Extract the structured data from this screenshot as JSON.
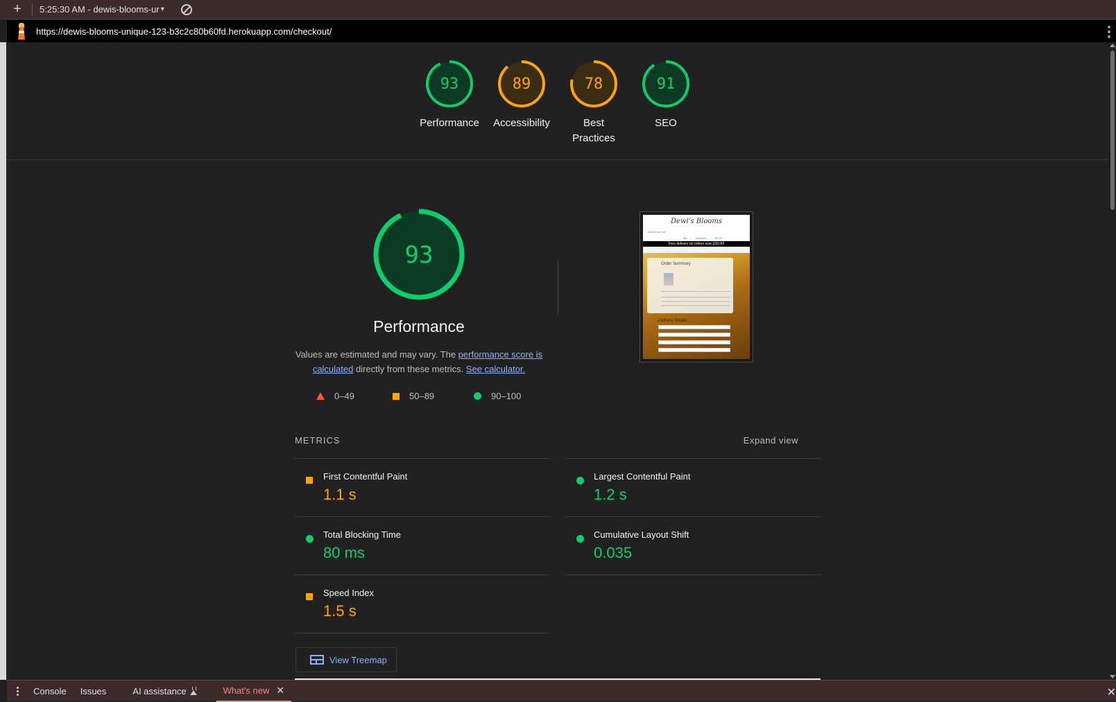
{
  "toolbar": {
    "plus": "+",
    "session_label": "5:25:30 AM - dewis-blooms-ur",
    "caret": "▾"
  },
  "urlbar": {
    "url": "https://dewis-blooms-unique-123-b3c2c80b60fd.herokuapp.com/checkout/"
  },
  "summary": {
    "gauges": [
      {
        "score": "93",
        "label": "Performance",
        "level": 0.93,
        "color": "#0cce6b",
        "bg": "#0c3a24",
        "text_color": "#0cce6b"
      },
      {
        "score": "89",
        "label": "Accessibility",
        "level": 0.89,
        "color": "#ffa400",
        "bg": "#3a2c12",
        "text_color": "#ffa400"
      },
      {
        "score": "78",
        "label": "Best Practices",
        "level": 0.78,
        "color": "#ffa400",
        "bg": "#3a2c12",
        "text_color": "#ffa400"
      },
      {
        "score": "91",
        "label": "SEO",
        "level": 0.91,
        "color": "#0cce6b",
        "bg": "#0c3a24",
        "text_color": "#0cce6b"
      }
    ]
  },
  "performance": {
    "score": "93",
    "level": 0.93,
    "title": "Performance",
    "desc_pre": "Values are estimated and may vary. The ",
    "link1": "performance score is calculated",
    "desc_mid": " directly from these metrics. ",
    "link2": "See calculator.",
    "legend": [
      "0–49",
      "50–89",
      "90–100"
    ]
  },
  "thumbnail": {
    "logo": "Dewi's Blooms",
    "search": "Search our site",
    "links": "My Account £0.00",
    "banner": "Free delivery on orders over £50.00!",
    "card_title": "Order Summary",
    "delivery": "Delivery Details"
  },
  "metrics": {
    "heading": "METRICS",
    "expand": "Expand view",
    "items": [
      {
        "name": "First Contentful Paint",
        "value": "1.1 s",
        "status": "average"
      },
      {
        "name": "Largest Contentful Paint",
        "value": "1.2 s",
        "status": "pass"
      },
      {
        "name": "Total Blocking Time",
        "value": "80 ms",
        "status": "pass"
      },
      {
        "name": "Cumulative Layout Shift",
        "value": "0.035",
        "status": "pass"
      },
      {
        "name": "Speed Index",
        "value": "1.5 s",
        "status": "average"
      }
    ],
    "treemap": "View Treemap"
  },
  "drawer": {
    "tabs": [
      "Console",
      "Issues",
      "AI assistance"
    ],
    "active_tab": "What's new",
    "close": "✕"
  }
}
